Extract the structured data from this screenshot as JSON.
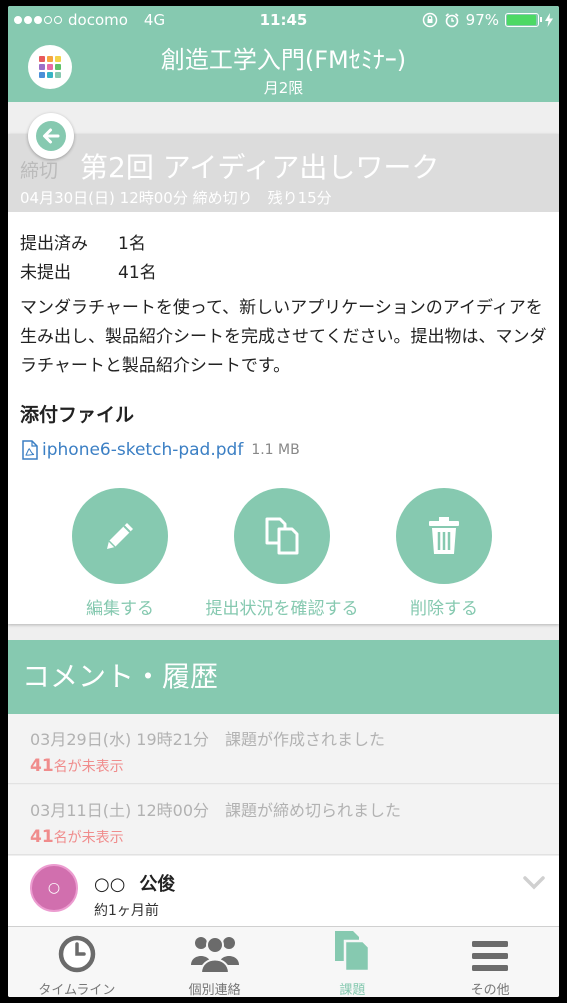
{
  "status_bar": {
    "carrier": "docomo",
    "network": "4G",
    "time": "11:45",
    "battery": "97%",
    "battery_level": 0.97
  },
  "header": {
    "title": "創造工学入門(FMｾﾐﾅｰ)",
    "subtitle": "月2限"
  },
  "assignment": {
    "prefix": "締切",
    "title": "第2回 アイディア出しワーク",
    "deadline": "04月30日(日) 12時00分 締め切り　残り15分",
    "stats": [
      {
        "label": "提出済み",
        "value": "1名"
      },
      {
        "label": "未提出",
        "value": "41名"
      }
    ],
    "description": "マンダラチャートを使って、新しいアプリケーションのアイディアを生み出し、製品紹介シートを完成させてください。提出物は、マンダラチャートと製品紹介シートです。",
    "attachments_heading": "添付ファイル",
    "attachment": {
      "name": "iphone6-sketch-pad.pdf",
      "size": "1.1 MB"
    },
    "actions": {
      "edit": "編集する",
      "status": "提出状況を確認する",
      "delete": "削除する"
    }
  },
  "comments": {
    "heading": "コメント・履歴",
    "history": [
      {
        "text": "03月29日(水) 19時21分　課題が作成されました",
        "count": "41",
        "suffix": "名が未表示"
      },
      {
        "text": "03月11日(土) 12時00分　課題が締め切られました",
        "count": "41",
        "suffix": "名が未表示"
      }
    ],
    "comment": {
      "avatar": "○",
      "name_prefix": "○○",
      "name": "公俊",
      "time": "約1ヶ月前"
    }
  },
  "tabs": [
    {
      "label": "タイムライン",
      "icon": "clock-icon"
    },
    {
      "label": "個別連絡",
      "icon": "people-icon"
    },
    {
      "label": "課題",
      "icon": "documents-icon"
    },
    {
      "label": "その他",
      "icon": "menu-icon"
    }
  ],
  "colors": {
    "accent": "#86c9b0",
    "link": "#3b7fc4",
    "unread": "#f08c8c"
  }
}
